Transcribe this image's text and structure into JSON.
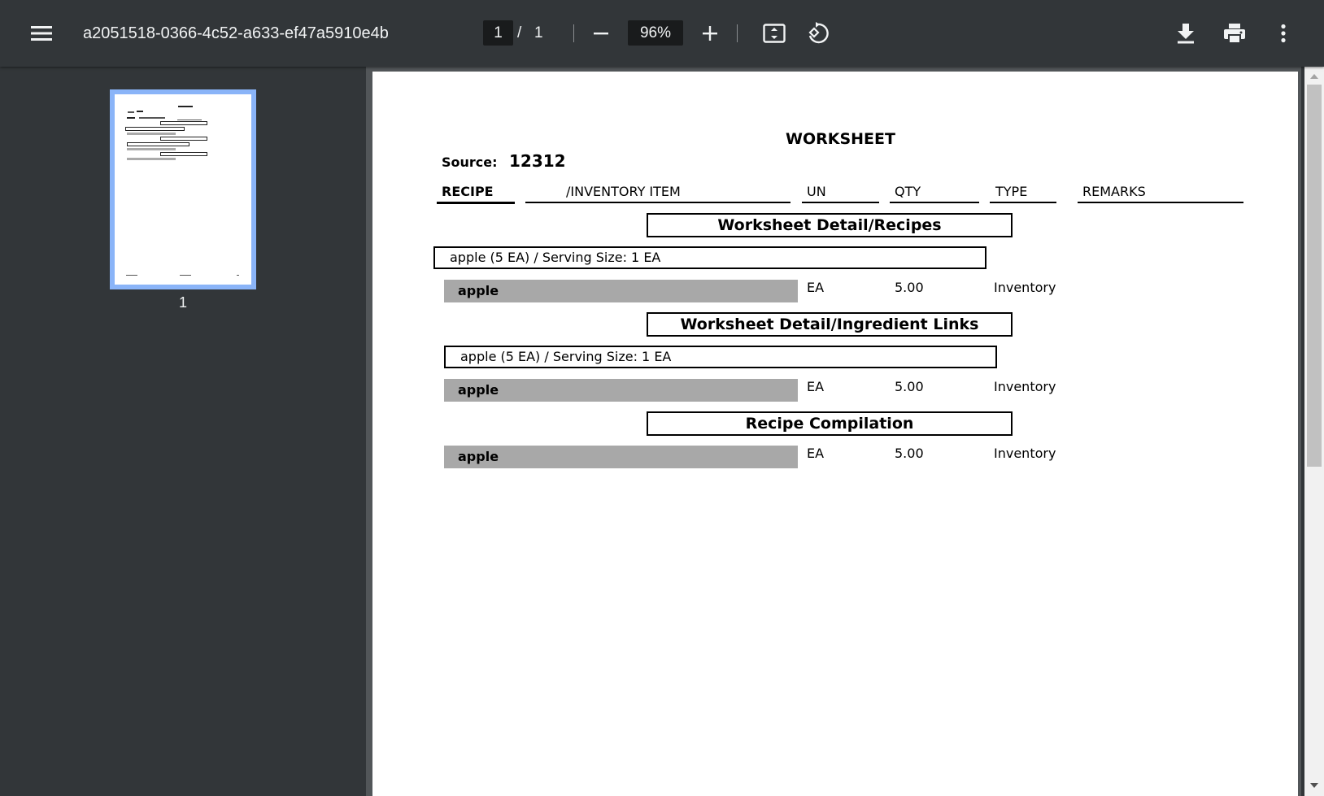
{
  "toolbar": {
    "title": "a2051518-0366-4c52-a633-ef47a5910e4b",
    "current_page": "1",
    "page_separator": "/",
    "total_pages": "1",
    "zoom": "96%"
  },
  "icons": {
    "menu": "menu-icon",
    "zoom_out": "minus-icon",
    "zoom_in": "plus-icon",
    "fit": "fit-page-icon",
    "rotate": "rotate-icon",
    "download": "download-icon",
    "print": "print-icon",
    "more": "more-vert-icon"
  },
  "sidebar": {
    "thumbnail_label": "1"
  },
  "document": {
    "title": "WORKSHEET",
    "source_label": "Source:",
    "source_value": "12312",
    "columns": [
      "RECIPE",
      "/INVENTORY ITEM",
      "UN",
      "QTY",
      "TYPE",
      "REMARKS"
    ],
    "sections": [
      {
        "heading": "Worksheet Detail/Recipes",
        "recipe_line": "apple (5 EA) / Serving Size: 1 EA",
        "item": {
          "name": "apple",
          "un": "EA",
          "qty": "5.00",
          "type": "Inventory"
        }
      },
      {
        "heading": "Worksheet Detail/Ingredient Links",
        "recipe_line": "apple (5 EA) / Serving Size: 1 EA",
        "item": {
          "name": "apple",
          "un": "EA",
          "qty": "5.00",
          "type": "Inventory"
        }
      },
      {
        "heading": "Recipe Compilation",
        "item": {
          "name": "apple",
          "un": "EA",
          "qty": "5.00",
          "type": "Inventory"
        }
      }
    ]
  },
  "colors": {
    "toolbar_bg": "#323639",
    "viewer_bg": "#525659",
    "thumb_border": "#8ab4f8",
    "gray_row": "#a8a8a8"
  }
}
